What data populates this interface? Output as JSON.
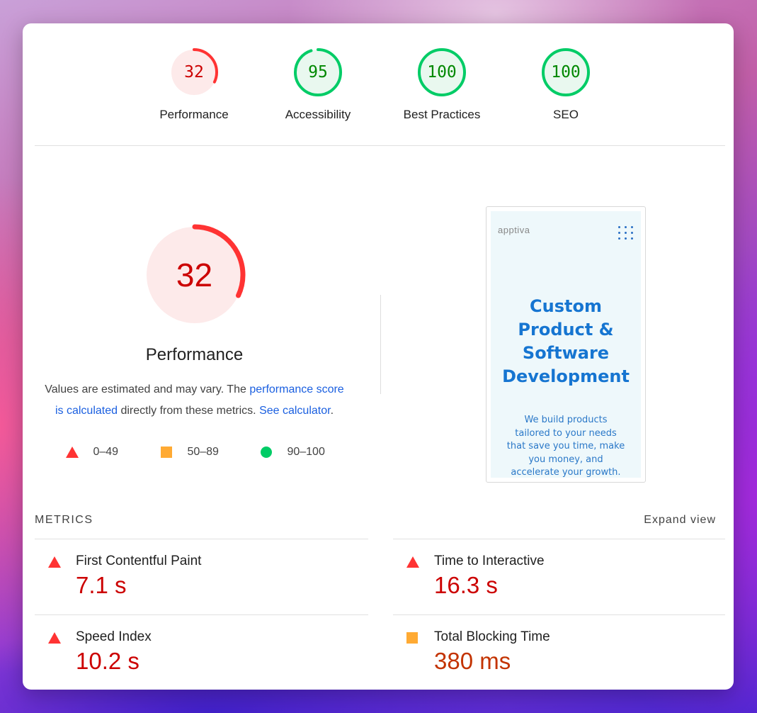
{
  "scores": [
    {
      "label": "Performance",
      "value": "32",
      "score": 32,
      "color": "#cc0000",
      "ring": "#ff3333",
      "bg": "#fdeaea"
    },
    {
      "label": "Accessibility",
      "value": "95",
      "score": 95,
      "color": "#008800",
      "ring": "#00cc66",
      "bg": "#e9f8ef"
    },
    {
      "label": "Best Practices",
      "value": "100",
      "score": 100,
      "color": "#008800",
      "ring": "#00cc66",
      "bg": "#e9f8ef"
    },
    {
      "label": "SEO",
      "value": "100",
      "score": 100,
      "color": "#008800",
      "ring": "#00cc66",
      "bg": "#e9f8ef"
    }
  ],
  "performance": {
    "value": "32",
    "score": 32,
    "title": "Performance",
    "desc_prefix": "Values are estimated and may vary. The ",
    "desc_link1": "performance score is calculated",
    "desc_middle": " directly from these metrics. ",
    "desc_link2": "See calculator",
    "desc_suffix": "."
  },
  "legend": [
    {
      "icon": "triangle-icon",
      "range": "0–49"
    },
    {
      "icon": "square-icon",
      "range": "50–89"
    },
    {
      "icon": "circle-icon",
      "range": "90–100"
    }
  ],
  "screenshot": {
    "logo": "apptiva",
    "heading": [
      "Custom",
      "Product &",
      "Software",
      "Development"
    ],
    "body": [
      "We build products",
      "tailored to your needs",
      "that save you time, make",
      "you money, and",
      "accelerate your growth."
    ]
  },
  "metrics": {
    "header": "METRICS",
    "expand": "Expand view",
    "items": [
      {
        "name": "First Contentful Paint",
        "value": "7.1 s",
        "status": "fail",
        "color": "#cc0000"
      },
      {
        "name": "Time to Interactive",
        "value": "16.3 s",
        "status": "fail",
        "color": "#cc0000"
      },
      {
        "name": "Speed Index",
        "value": "10.2 s",
        "status": "fail",
        "color": "#cc0000"
      },
      {
        "name": "Total Blocking Time",
        "value": "380 ms",
        "status": "average",
        "color": "#c33300"
      }
    ]
  }
}
